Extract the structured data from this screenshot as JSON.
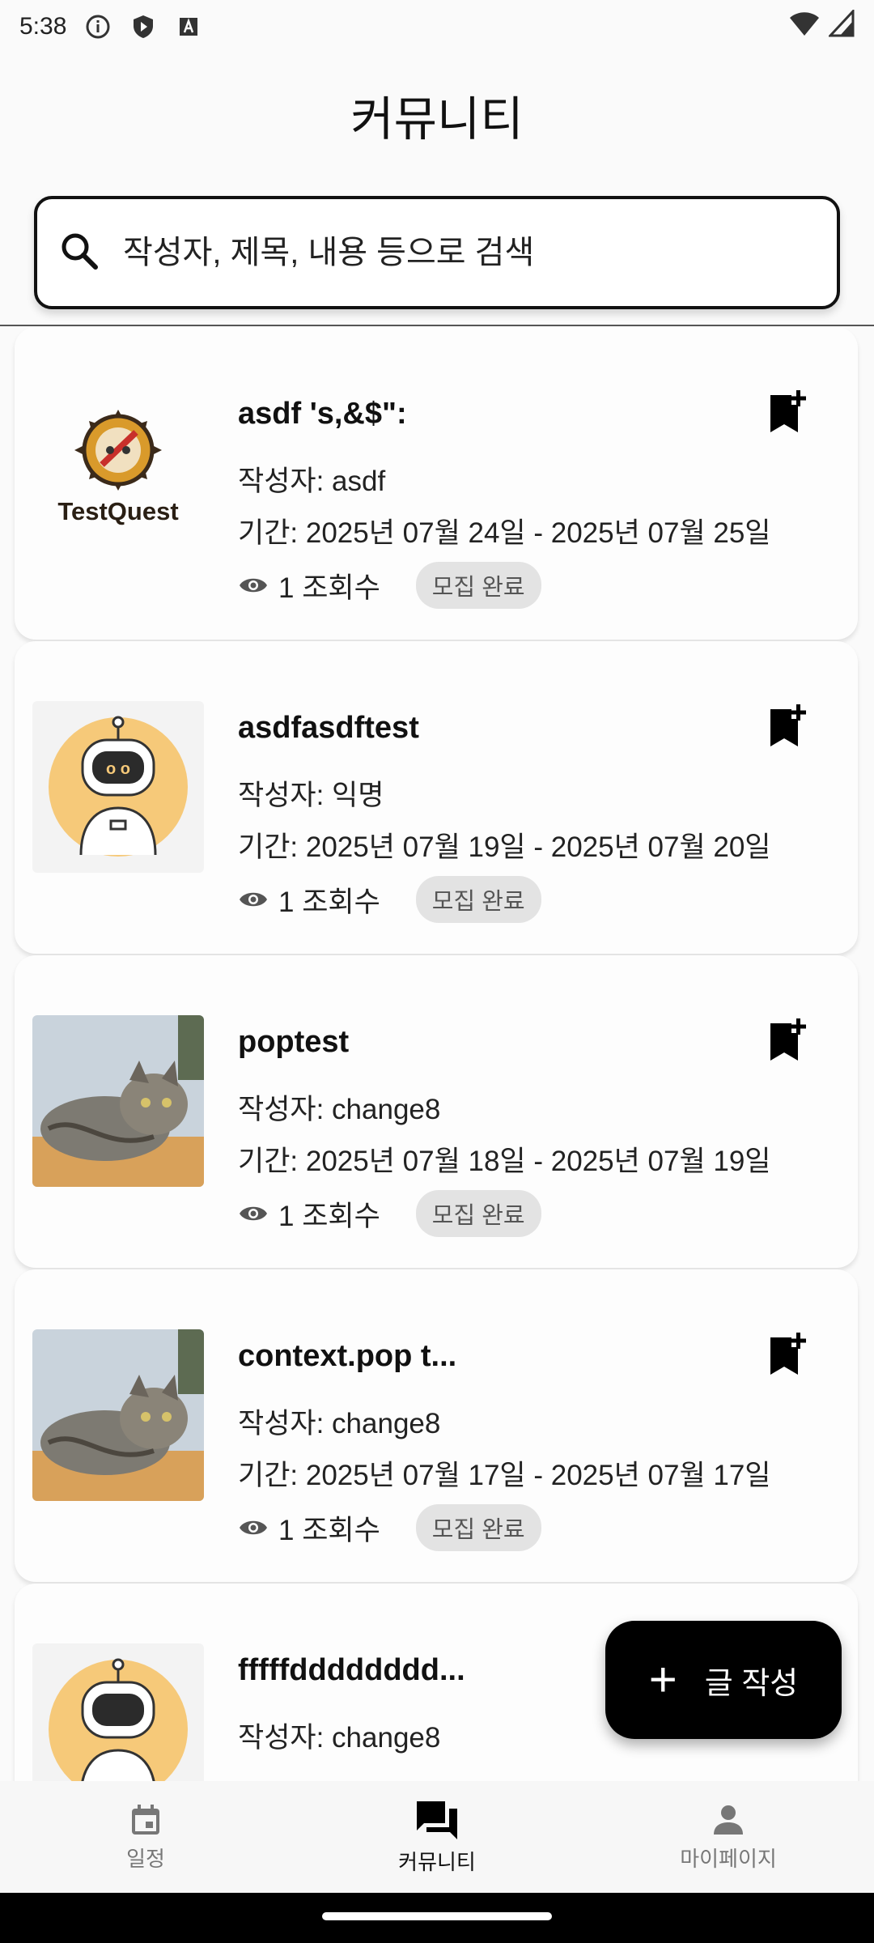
{
  "status_bar": {
    "time": "5:38",
    "icons": [
      "info-icon",
      "shield-icon",
      "keyboard-a-icon",
      "wifi-icon",
      "signal-icon"
    ]
  },
  "header": {
    "title": "커뮤니티"
  },
  "search": {
    "placeholder": "작성자, 제목, 내용 등으로 검색"
  },
  "posts": [
    {
      "title": "asdf 's,&$\":",
      "author": "작성자: asdf",
      "period": "기간: 2025년 07월 24일 - 2025년 07월 25일",
      "views": "1 조회수",
      "status": "모집 완료",
      "thumb_logo_text": "TestQuest"
    },
    {
      "title": "asdfasdftest",
      "author": "작성자: 익명",
      "period": "기간: 2025년 07월 19일 - 2025년 07월 20일",
      "views": "1 조회수",
      "status": "모집 완료"
    },
    {
      "title": "poptest",
      "author": "작성자: change8",
      "period": "기간: 2025년 07월 18일 - 2025년 07월 19일",
      "views": "1 조회수",
      "status": "모집 완료"
    },
    {
      "title": "context.pop t...",
      "author": "작성자: change8",
      "period": "기간: 2025년 07월 17일 - 2025년 07월 17일",
      "views": "1 조회수",
      "status": "모집 완료"
    },
    {
      "title": "fffffdddddddd...",
      "author": "작성자: change8"
    }
  ],
  "fab": {
    "label": "글 작성"
  },
  "bottom_nav": {
    "items": [
      {
        "label": "일정",
        "icon": "calendar-icon"
      },
      {
        "label": "커뮤니티",
        "icon": "forum-icon"
      },
      {
        "label": "마이페이지",
        "icon": "person-icon"
      }
    ],
    "active": "커뮤니티"
  },
  "colors": {
    "background": "#fafafa",
    "primary": "#000000",
    "badge_bg": "#e3e3e3",
    "robot_bg": "#f6c979"
  }
}
